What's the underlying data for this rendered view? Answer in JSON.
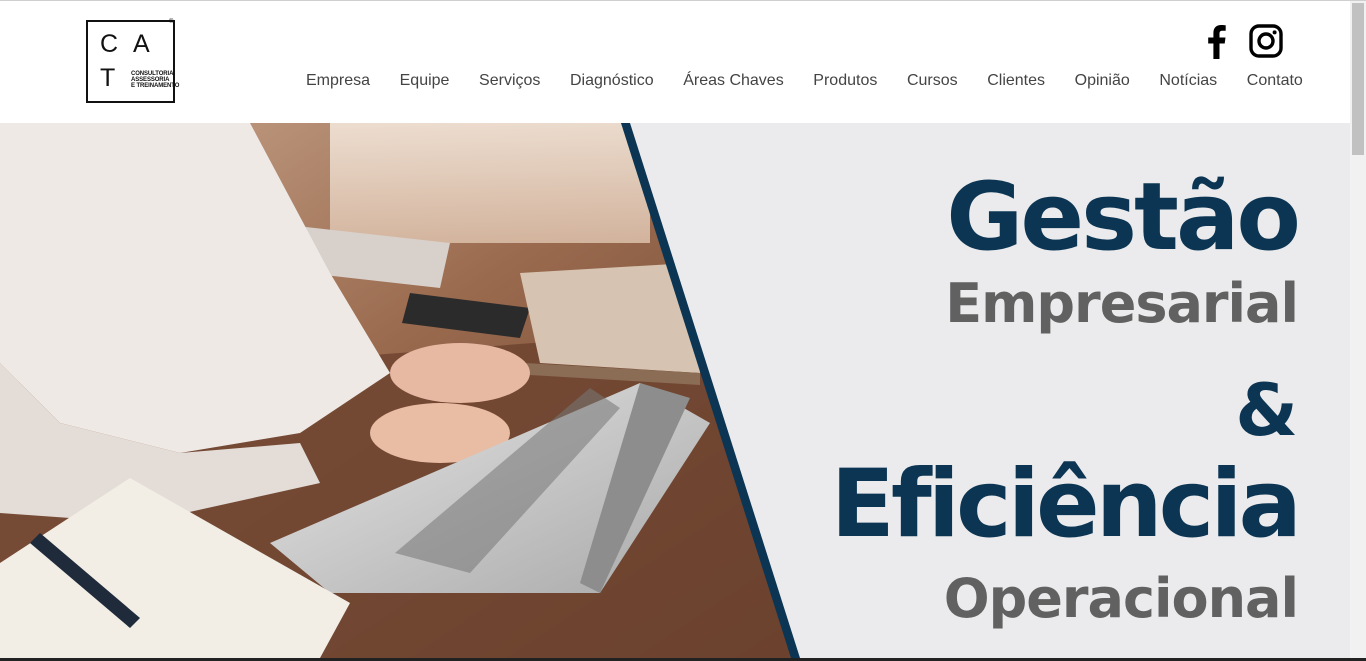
{
  "logo": {
    "letters": [
      "C",
      "A",
      "T"
    ],
    "subtitle": [
      "CONSULTORIA",
      "ASSESSORIA",
      "E TREINAMENTO"
    ],
    "registered": "®"
  },
  "social": {
    "facebook_icon": "facebook-icon",
    "instagram_icon": "instagram-icon"
  },
  "nav": {
    "items": [
      {
        "label": "Empresa"
      },
      {
        "label": "Equipe"
      },
      {
        "label": "Serviços"
      },
      {
        "label": "Diagnóstico"
      },
      {
        "label": "Áreas Chaves"
      },
      {
        "label": "Produtos"
      },
      {
        "label": "Cursos"
      },
      {
        "label": "Clientes"
      },
      {
        "label": "Opinião"
      },
      {
        "label": "Notícias"
      },
      {
        "label": "Contato"
      }
    ]
  },
  "hero": {
    "line1": "Gestão",
    "line2": "Empresarial",
    "line3": "&",
    "line4": "Eficiência",
    "line5": "Operacional",
    "colors": {
      "primary": "#0b3553",
      "secondary": "#616161",
      "background": "#ebebed"
    }
  }
}
